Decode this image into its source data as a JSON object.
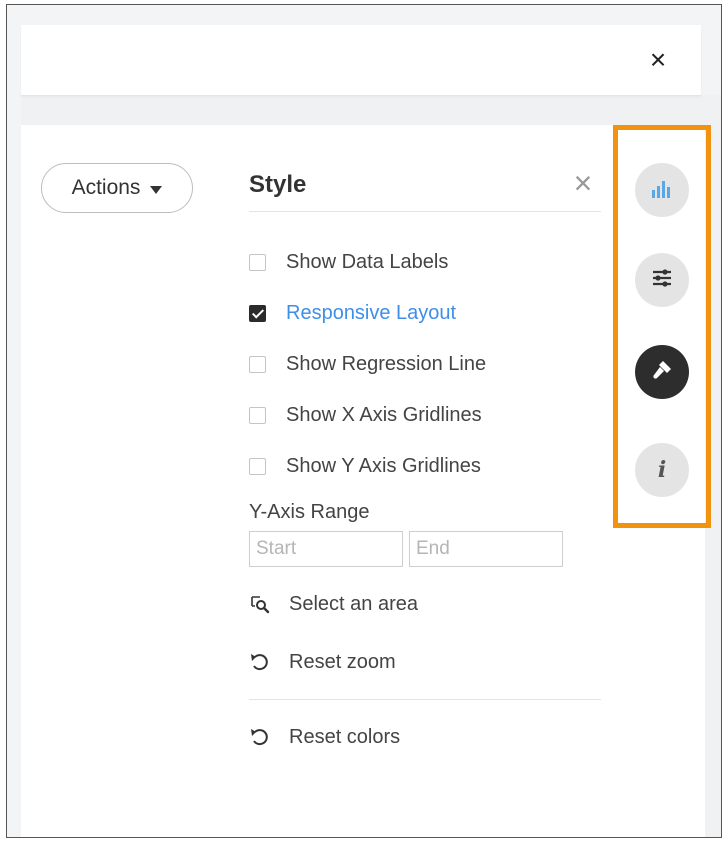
{
  "header": {
    "close_label": "×"
  },
  "left": {
    "actions_label": "Actions"
  },
  "style_panel": {
    "title": "Style",
    "close_label": "×",
    "options": [
      {
        "label": "Show Data Labels",
        "checked": false
      },
      {
        "label": "Responsive Layout",
        "checked": true
      },
      {
        "label": "Show Regression Line",
        "checked": false
      },
      {
        "label": "Show X Axis Gridlines",
        "checked": false
      },
      {
        "label": "Show Y Axis Gridlines",
        "checked": false
      }
    ],
    "y_axis_range": {
      "label": "Y-Axis Range",
      "start_placeholder": "Start",
      "end_placeholder": "End"
    },
    "actions": {
      "select_area": "Select an area",
      "reset_zoom": "Reset zoom",
      "reset_colors": "Reset colors"
    }
  },
  "toolbar": {
    "buttons": [
      {
        "icon": "bar-chart-icon",
        "active": false
      },
      {
        "icon": "sliders-icon",
        "active": false
      },
      {
        "icon": "paintbrush-icon",
        "active": true
      },
      {
        "icon": "info-icon",
        "active": false
      }
    ],
    "info_glyph": "i"
  },
  "colors": {
    "accent_link": "#3f8ee8",
    "highlight_border": "#f2930f",
    "active_tool": "#2d2d2d",
    "chart_icon": "#5aa7e6"
  }
}
